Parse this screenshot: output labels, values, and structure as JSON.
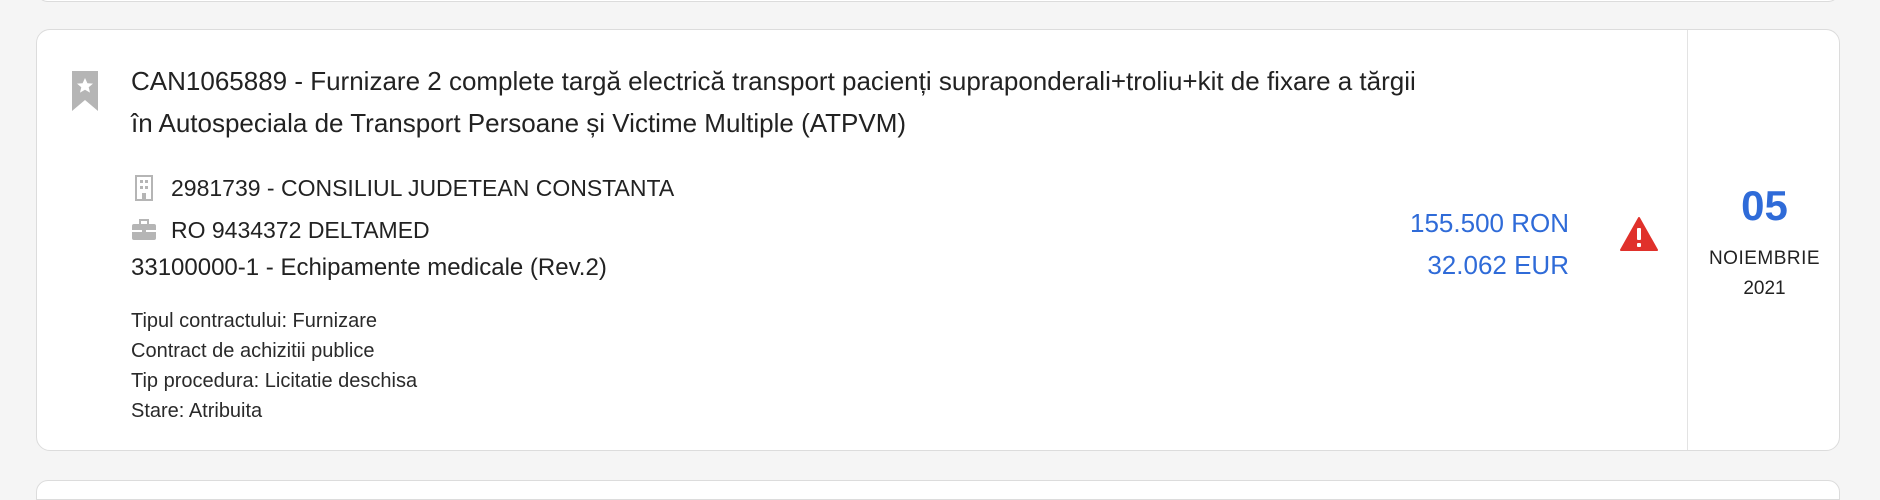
{
  "notice": {
    "title": "CAN1065889 - Furnizare 2 complete targă electrică transport pacienți supraponderali+troliu+kit de fixare a tărgii în Autospeciala de Transport Persoane și Victime Multiple (ATPVM)",
    "authority": "2981739 - CONSILIUL JUDETEAN CONSTANTA",
    "supplier": "RO 9434372 DELTAMED",
    "cpv": "33100000-1 - Echipamente medicale (Rev.2)",
    "details": [
      "Tipul contractului: Furnizare",
      "Contract de achizitii publice",
      "Tip procedura: Licitatie deschisa",
      "Stare: Atribuita"
    ],
    "value_ron": "155.500 RON",
    "value_eur": "32.062 EUR",
    "date": {
      "day": "05",
      "month": "NOIEMBRIE",
      "year": "2021"
    }
  },
  "icons": {
    "bookmark": "bookmark-star-icon",
    "authority": "building-icon",
    "supplier": "briefcase-icon",
    "alert": "warning-triangle-icon"
  },
  "colors": {
    "accent": "#2f6bd8",
    "warning": "#e0312b",
    "icon_grey": "#b5b5b5"
  }
}
